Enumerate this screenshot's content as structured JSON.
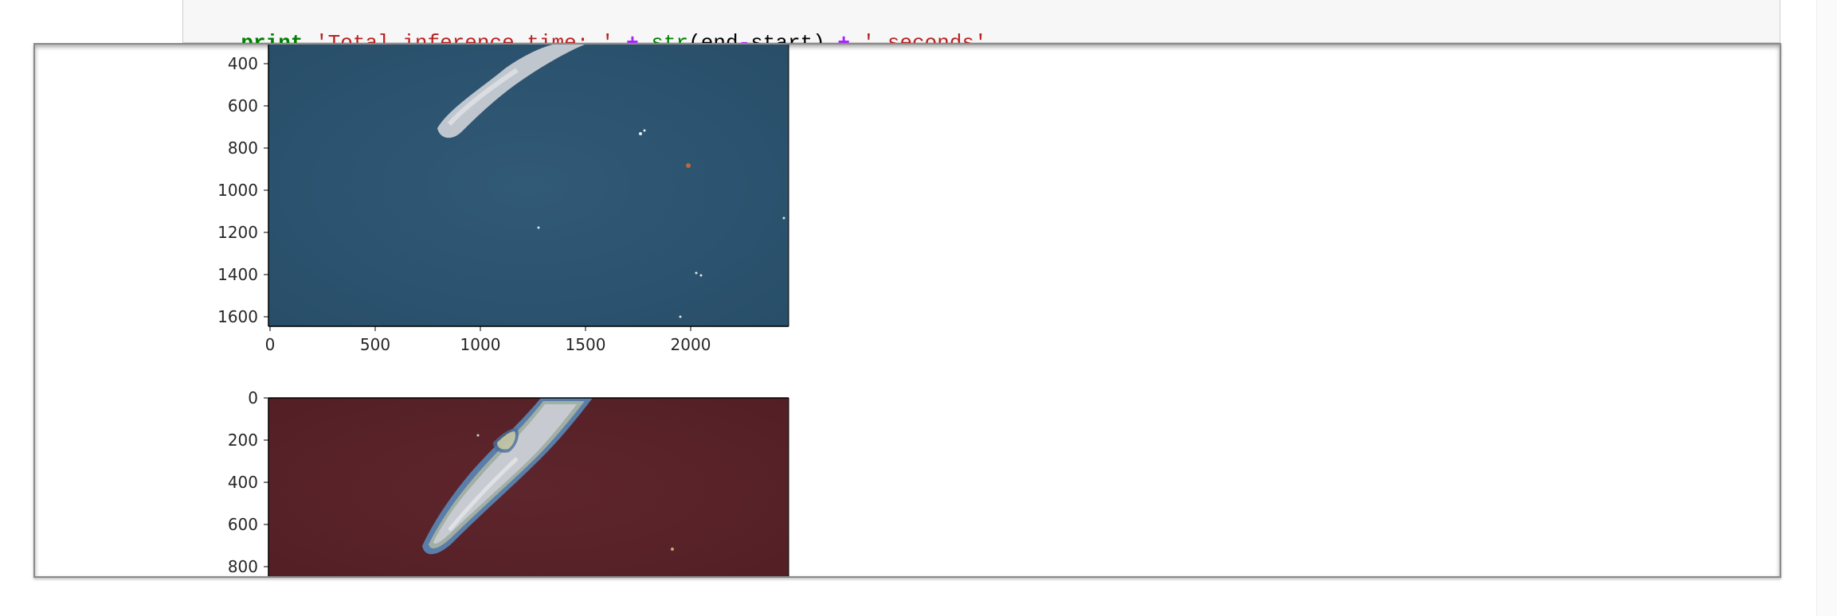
{
  "code_cell": {
    "line": {
      "keyword": "print",
      "string1": "'Total inference time: '",
      "op1": "+",
      "builtin": "str",
      "paren_open": "(",
      "var1": "end",
      "minus": "-",
      "var2": "start",
      "paren_close": ")",
      "op2": "+",
      "string2": "' seconds'"
    }
  },
  "plots": [
    {
      "name": "satellite-image-plot",
      "y_tick_labels": [
        "400",
        "600",
        "800",
        "1000",
        "1200",
        "1400",
        "1600"
      ],
      "x_tick_labels": [
        "0",
        "500",
        "1000",
        "1500",
        "2000"
      ]
    },
    {
      "name": "segmentation-overlay-plot",
      "y_tick_labels": [
        "0",
        "200",
        "400",
        "600",
        "800"
      ]
    }
  ],
  "colors": {
    "ocean": "#2d5470",
    "overlay": "#5a2328",
    "whale": "#c8ccd2",
    "contour_outer": "#2f6fb0",
    "contour_inner": "#e8d870"
  }
}
